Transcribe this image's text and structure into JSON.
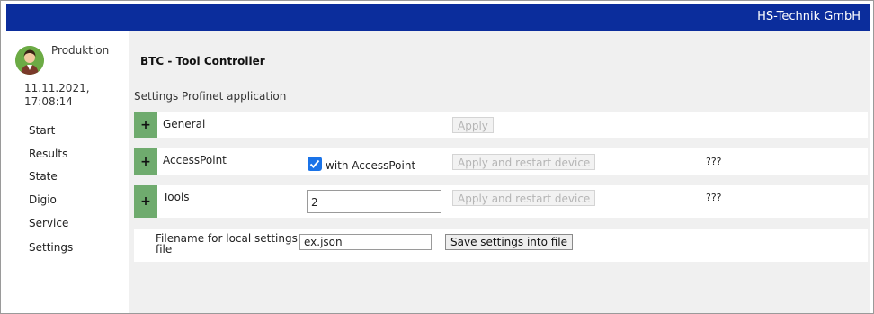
{
  "header": {
    "brand": "HS-Technik GmbH"
  },
  "sidebar": {
    "user": "Produktion",
    "datetime_line1": "11.11.2021,",
    "datetime_line2": "17:08:14",
    "items": [
      {
        "label": "Start"
      },
      {
        "label": "Results"
      },
      {
        "label": "State"
      },
      {
        "label": "Digio"
      },
      {
        "label": "Service"
      },
      {
        "label": "Settings"
      }
    ]
  },
  "main": {
    "title": "BTC - Tool Controller",
    "section": "Settings Profinet application",
    "general": {
      "label": "General",
      "expand": "+",
      "apply": "Apply"
    },
    "accesspoint": {
      "label": "AccessPoint",
      "expand": "+",
      "checkbox_label": "with AccessPoint",
      "checked": true,
      "apply": "Apply and restart device",
      "status": "???"
    },
    "tools": {
      "label": "Tools",
      "expand": "+",
      "value": "2",
      "apply": "Apply and restart device",
      "status": "???"
    },
    "file": {
      "label_line1": "Filename for local settings",
      "label_line2": "file",
      "value": "ex.json",
      "save": "Save settings into file"
    }
  },
  "colors": {
    "topbar": "#0b2d9c",
    "expand": "#6fab6e",
    "checkbox": "#1a73e8",
    "main_bg": "#f0f0f0"
  },
  "icons": {
    "avatar": "user-avatar-icon",
    "check": "checkmark-icon"
  }
}
